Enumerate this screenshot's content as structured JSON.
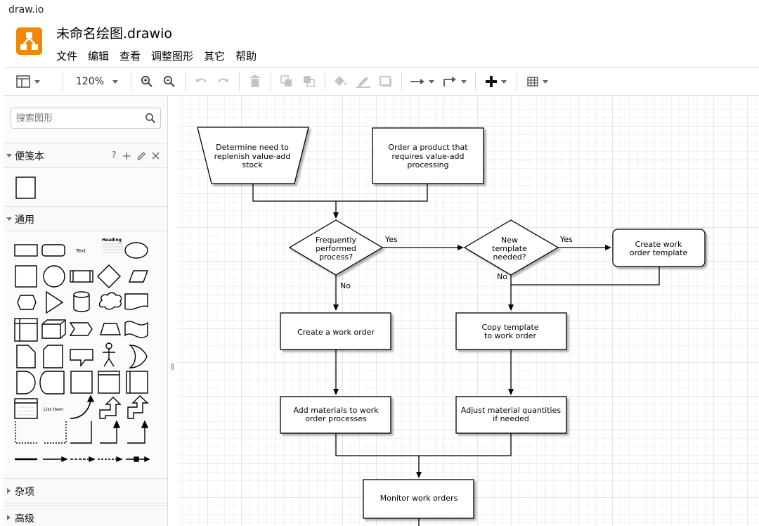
{
  "window": {
    "title": "draw.io"
  },
  "header": {
    "file_title": "未命名绘图.drawio",
    "menu": [
      "文件",
      "编辑",
      "查看",
      "调整图形",
      "其它",
      "帮助"
    ]
  },
  "toolbar": {
    "zoom": "120%"
  },
  "sidebar": {
    "search_placeholder": "搜索图形",
    "scratchpad": {
      "title": "便笺本",
      "help": "?",
      "add": "+"
    },
    "general": {
      "title": "通用",
      "text_shape": "Text",
      "heading_shape": "Heading",
      "list_item_shape": "List Item"
    },
    "misc": {
      "title": "杂项"
    },
    "advanced": {
      "title": "高级"
    }
  },
  "diagram": {
    "replenish": [
      "Determine need to",
      "replenish value-add",
      "stock"
    ],
    "order_product": [
      "Order a product that",
      "requires value-add",
      "processing"
    ],
    "frequently": [
      "Frequently",
      "performed",
      "process?"
    ],
    "new_template": [
      "New",
      "template",
      "needed?"
    ],
    "create_template": [
      "Create work",
      "order template"
    ],
    "create_order": "Create a work order",
    "copy_template": [
      "Copy template",
      "to work order"
    ],
    "add_materials": [
      "Add materials to work",
      "order processes"
    ],
    "adjust_materials": [
      "Adjust material quantities",
      "if needed"
    ],
    "monitor": "Monitor work orders",
    "yes1": "Yes",
    "yes2": "Yes",
    "no1": "No",
    "no2": "No"
  },
  "colors": {
    "accent": "#f08705",
    "line": "#000000",
    "grid": "#e6e6e6"
  }
}
